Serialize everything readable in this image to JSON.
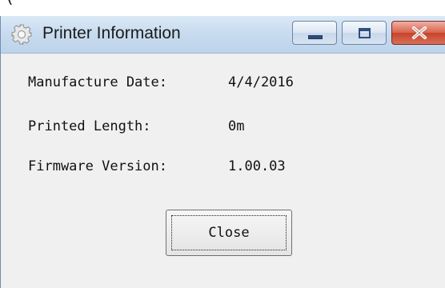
{
  "background_clip_text": "(",
  "window": {
    "title": "Printer Information",
    "icon": "gear-icon",
    "controls": {
      "minimize": "minimize-icon",
      "maximize": "maximize-icon",
      "close": "close-icon"
    }
  },
  "info": {
    "manufacture_date": {
      "label": "Manufacture Date:",
      "value": "4/4/2016"
    },
    "printed_length": {
      "label": "Printed Length:",
      "value": "0m"
    },
    "firmware_version": {
      "label": "Firmware Version:",
      "value": "1.00.03"
    }
  },
  "buttons": {
    "close_label": "Close"
  },
  "colors": {
    "titlebar": "#c9dcef",
    "window_bg": "#f0f0f0",
    "close_button": "#c6422a"
  }
}
